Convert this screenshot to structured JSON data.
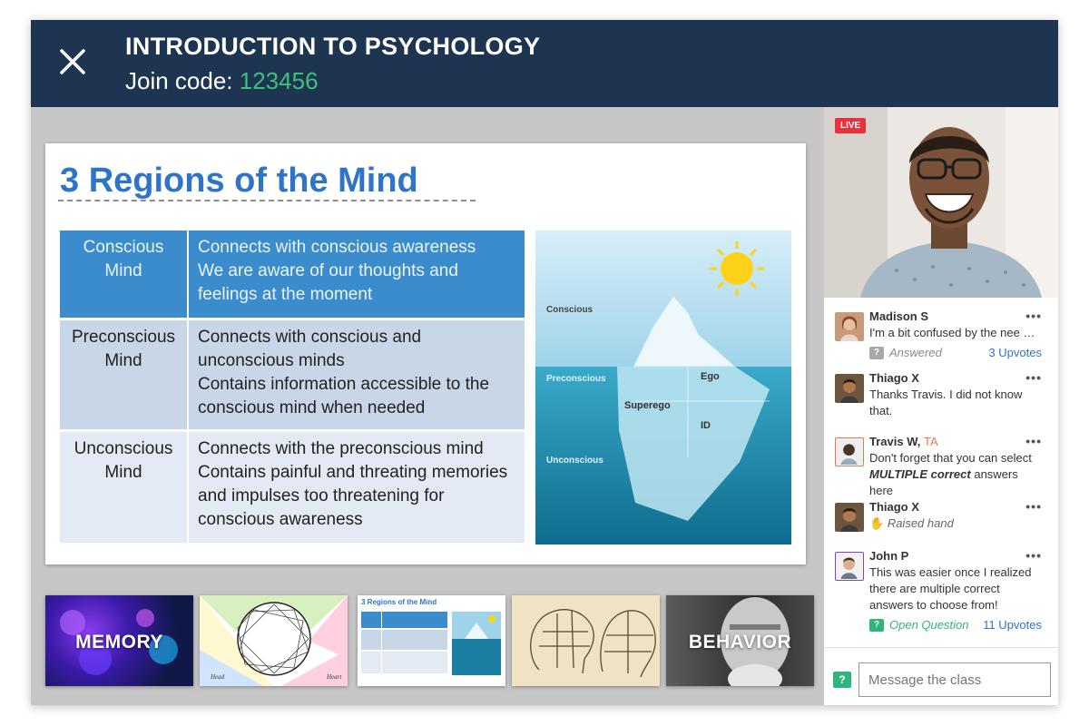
{
  "header": {
    "title": "INTRODUCTION TO PSYCHOLOGY",
    "join_label": "Join code:",
    "join_code": "123456",
    "accent": "#1e3552",
    "code_color": "#3dc17a"
  },
  "slide": {
    "title": "3 Regions of the Mind",
    "rows": [
      {
        "name_l1": "Conscious",
        "name_l2": "Mind",
        "desc": [
          "Connects with conscious awareness",
          "We are aware of our thoughts and",
          "feelings at the moment"
        ]
      },
      {
        "name_l1": "Preconscious",
        "name_l2": "Mind",
        "desc": [
          "Connects with conscious and",
          "unconscious minds",
          "Contains information accessible to the",
          "conscious mind when needed"
        ]
      },
      {
        "name_l1": "Unconscious",
        "name_l2": "Mind",
        "desc": [
          "Connects with the preconscious mind",
          "Contains painful and threating memories",
          "and impulses too threatening for",
          "conscious awareness"
        ]
      }
    ],
    "iceberg": {
      "conscious": "Conscious",
      "preconscious": "Preconscious",
      "unconscious": "Unconscious",
      "ego": "Ego",
      "superego": "Superego",
      "id": "ID"
    }
  },
  "thumbnails": [
    {
      "label": "MEMORY"
    },
    {
      "label": "",
      "left_caption": "Head",
      "right_caption": "Heart"
    },
    {
      "label": "",
      "mini_title": "3 Regions of the Mind"
    },
    {
      "label": ""
    },
    {
      "label": "BEHAVIOR"
    }
  ],
  "video": {
    "live_label": "LIVE"
  },
  "chat": {
    "messages": [
      {
        "name": "Madison S",
        "text": "I'm a bit confused by the nee …",
        "status": "Answered",
        "upvotes": "3 Upvotes"
      },
      {
        "name": "Thiago X",
        "text_l1": "Thanks Travis. I did not know",
        "text_l2": "that."
      },
      {
        "name": "Travis W,",
        "role": "TA",
        "text_l1": "Don't forget that you can select",
        "text_bold": "MULTIPLE correct",
        "text_rest": "answers here"
      },
      {
        "name": "Thiago X",
        "text": "Raised hand",
        "hand_icon": "✋"
      },
      {
        "name": "John P",
        "text_l1": "This was easier once I realized",
        "text_l2": "there are multiple correct",
        "text_l3": "answers to choose from!",
        "status": "Open Question",
        "upvotes": "11 Upvotes"
      }
    ],
    "more_icon": "•••",
    "composer_placeholder": "Message the class"
  }
}
